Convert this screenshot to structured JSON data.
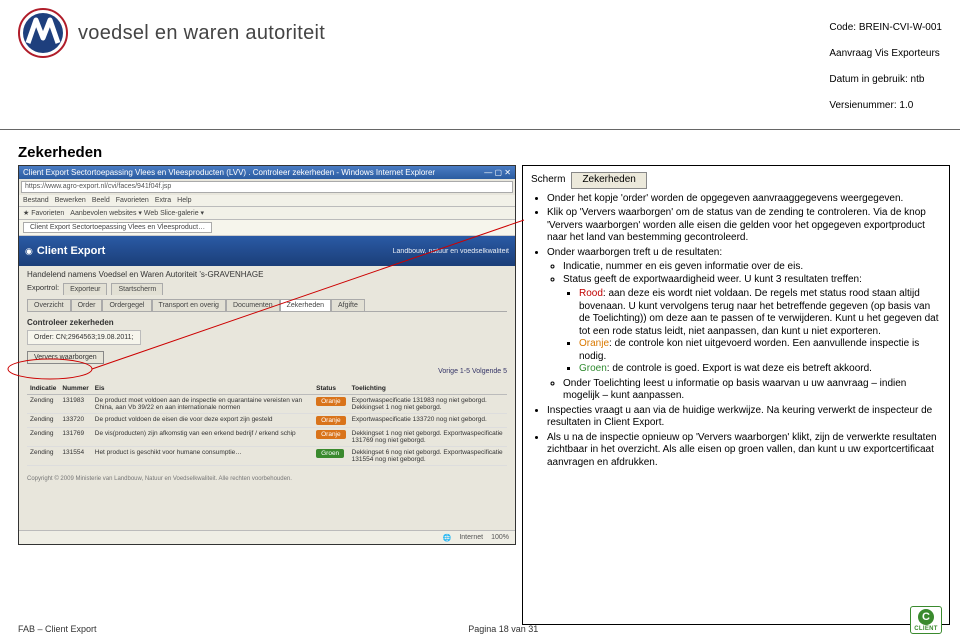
{
  "meta": {
    "code": "Code: BREIN-CVI-W-001",
    "title": "Aanvraag Vis Exporteurs",
    "date": "Datum in gebruik: ntb",
    "version": "Versienummer: 1.0"
  },
  "brand": "voedsel en waren autoriteit",
  "section_title": "Zekerheden",
  "screenshot": {
    "window_title": "Client Export Sectortoepassing Vlees en Vleesproducten (LVV) . Controleer zekerheden - Windows Internet Explorer",
    "addr": "https://www.agro-export.nl/cvi/faces/941f04f.jsp",
    "menubar": [
      "Bestand",
      "Bewerken",
      "Beeld",
      "Favorieten",
      "Extra",
      "Help"
    ],
    "favbar": "Aanbevolen websites ▾   Web Slice-galerie ▾",
    "tab_label": "Client Export Sectortoepassing Vlees en Vleesproduct…",
    "app_title": "Client Export",
    "subtitle": "Handelend namens Voedsel en Waren Autoriteit ’s-GRAVENHAGE",
    "role_tabs": [
      "Exportrol:",
      "Exporteur",
      "Startscherm"
    ],
    "main_tabs": [
      "Overzicht",
      "Order",
      "Ordergegel",
      "Transport en overig",
      "Documenten",
      "Zekerheden",
      "Afgifte"
    ],
    "panel_title": "Controleer zekerheden",
    "order_label": "Order: CN;2964563;19.08.2011;",
    "ververs_label": "Ververs waarborgen",
    "pager": "Vorige   1-5   Volgende 5",
    "table": {
      "headers": [
        "Indicatie",
        "Nummer",
        "Eis",
        "Status",
        "Toelichting"
      ],
      "rows": [
        {
          "ind": "Zending",
          "num": "131983",
          "eis": "De product moet voldoen aan de inspectie en quarantaine vereisten van China, aan Vb 39/22 en aan internationale normen",
          "status": "Oranje",
          "toe": "Exportwaspecificatie 131983 nog niet geborgd. Dekkingset 1 nog niet geborgd."
        },
        {
          "ind": "Zending",
          "num": "133720",
          "eis": "De product voldoen de eisen die voor deze export zijn gesteld",
          "status": "Oranje",
          "toe": "Exportwaspecificatie 133720 nog niet geborgd."
        },
        {
          "ind": "Zending",
          "num": "131769",
          "eis": "De vis(producten) zijn afkomstig van een erkend bedrijf / erkend schip",
          "status": "Oranje",
          "toe": "Dekkingset 1 nog niet geborgd. Exportwaspecificatie 131769 nog niet geborgd."
        },
        {
          "ind": "Zending",
          "num": "131554",
          "eis": "Het product is geschikt voor humane consumptie…",
          "status": "Groen",
          "toe": "Dekkingset 6 nog niet geborgd. Exportwaspecificatie 131554 nog niet geborgd."
        }
      ]
    },
    "copyright": "Copyright © 2009 Ministerie van Landbouw, Natuur en Voedselkwaliteit.  Alle rechten voorbehouden.",
    "statusbar": [
      "Internet",
      "100%"
    ]
  },
  "instructions": {
    "scherm": "Scherm",
    "scherm_btn": "Zekerheden",
    "b1": "Onder het kopje 'order' worden de opgegeven aanvraaggegevens weergegeven.",
    "b2": "Klik op 'Ververs waarborgen' om de status van de zending te controleren. Via de knop 'Ververs waarborgen' worden alle eisen die gelden voor het opgegeven exportproduct naar het land van bestemming gecontroleerd.",
    "b3": "Onder waarborgen treft u de resultaten:",
    "b3a": "Indicatie, nummer en eis geven informatie over de eis.",
    "b3b": "Status geeft de exportwaardigheid weer. U kunt 3 resultaten treffen:",
    "red_label": "Rood",
    "red_text": ": aan deze eis wordt niet voldaan. De regels met status rood staan altijd bovenaan. U kunt vervolgens terug naar het betreffende gegeven (op basis van de Toelichting)) om deze aan te passen of te verwijderen. Kunt u het gegeven dat tot een rode status leidt, niet aanpassen, dan kunt u niet exporteren.",
    "orange_label": "Oranje",
    "orange_text": ": de controle kon niet uitgevoerd worden. Een aanvullende inspectie is nodig.",
    "green_label": "Groen",
    "green_text": ": de controle is goed. Export is wat deze eis betreft akkoord.",
    "b3c": "Onder Toelichting leest u informatie op basis waarvan u uw aanvraag – indien mogelijk – kunt aanpassen.",
    "b4": "Inspecties vraagt u aan via de huidige werkwijze. Na keuring verwerkt de inspecteur de resultaten in Client Export.",
    "b5": "Als u na de inspectie opnieuw op 'Ververs waarborgen' klikt, zijn de verwerkte resultaten zichtbaar in het overzicht. Als alle eisen op groen vallen, dan kunt u uw exportcertificaat aanvragen en afdrukken."
  },
  "footer": {
    "left": "FAB – Client Export",
    "center": "Pagina 18 van 31",
    "badge": "CLIENT"
  }
}
